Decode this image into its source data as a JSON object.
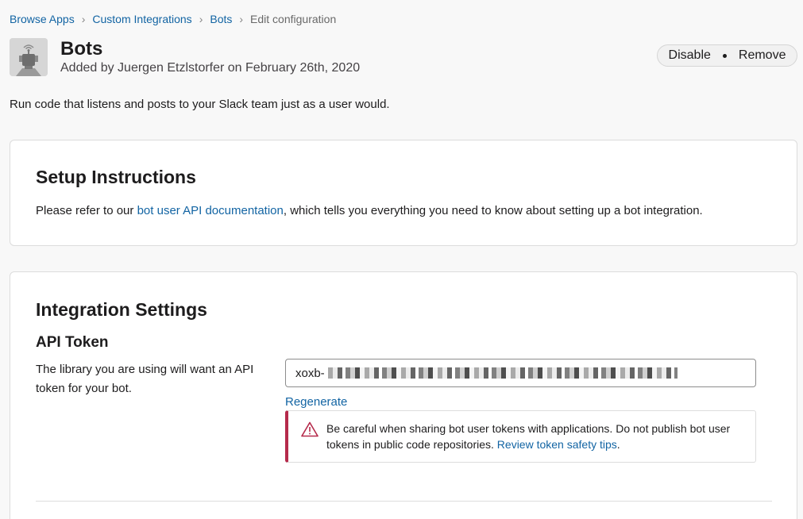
{
  "breadcrumb": {
    "items": [
      "Browse Apps",
      "Custom Integrations",
      "Bots"
    ],
    "current": "Edit configuration"
  },
  "app": {
    "title": "Bots",
    "subtitle": "Added by Juergen Etzlstorfer on February 26th, 2020",
    "icon": "robot-icon",
    "description": "Run code that listens and posts to your Slack team just as a user would."
  },
  "actions": {
    "disable_label": "Disable",
    "remove_label": "Remove"
  },
  "setup": {
    "heading": "Setup Instructions",
    "text_before": "Please refer to our ",
    "link_text": "bot user API documentation",
    "text_after": ", which tells you everything you need to know about setting up a bot integration."
  },
  "settings": {
    "heading": "Integration Settings",
    "api_token": {
      "label": "API Token",
      "help": "The library you are using will want an API token for your bot.",
      "value_prefix": "xoxb-",
      "regenerate_label": "Regenerate",
      "warning_text": "Be careful when sharing bot user tokens with applications. Do not publish bot user tokens in public code repositories. ",
      "warning_link": "Review token safety tips",
      "warning_end": "."
    }
  },
  "colors": {
    "link": "#1264a3",
    "warning_accent": "#b52a4b"
  }
}
